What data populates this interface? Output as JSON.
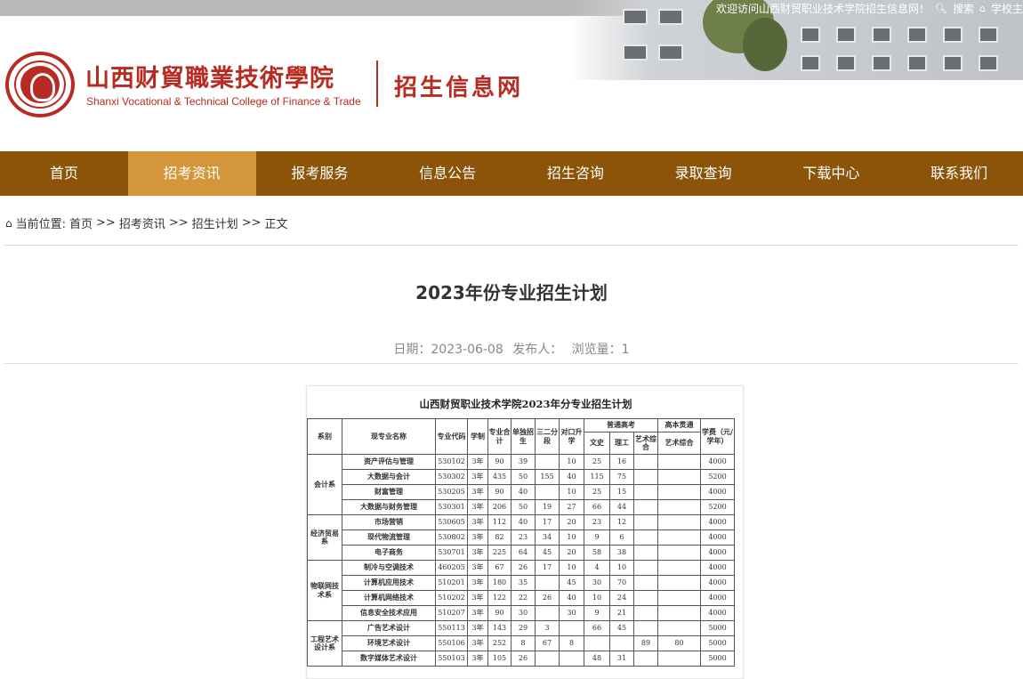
{
  "topbar": {
    "welcome": "欢迎访问山西财贸职业技术学院招生信息网！",
    "search": "搜索",
    "home": "学校主"
  },
  "logo": {
    "school_cn": "山西财貿職業技術學院",
    "school_en": "Shanxi Vocational & Technical College of Finance & Trade",
    "site_title": "招生信息网"
  },
  "nav": [
    "首页",
    "招考资讯",
    "报考服务",
    "信息公告",
    "招生咨询",
    "录取查询",
    "下载中心",
    "联系我们"
  ],
  "nav_active": "招考资讯",
  "breadcrumb": {
    "label": "当前位置:",
    "items": [
      "首页",
      "招考资讯",
      "招生计划",
      "正文"
    ],
    "sep": ">>"
  },
  "article": {
    "title": "2023年份专业招生计划",
    "date": "日期：2023-06-08",
    "publisher": "发布人：",
    "views": "浏览量：1"
  },
  "plan_table": {
    "title": "山西财贸职业技术学院2023年分专业招生计划",
    "headers": {
      "dept": "系别",
      "major": "现专业名称",
      "code": "专业代码",
      "years": "学制",
      "total": "专业合计",
      "single": "单独招生",
      "three_two": "三二分段",
      "duikou": "对口升学",
      "gaokao": "普通高考",
      "wenshi": "文史",
      "ligong": "理工",
      "art": "艺术综合",
      "guantong": "高本贯通",
      "gt_art": "艺术综合",
      "fee": "学费（元/学年）"
    },
    "groups": [
      {
        "dept": "会计系",
        "rows": [
          [
            "资产评估与管理",
            "530102",
            "3年",
            "90",
            "39",
            "",
            "10",
            "25",
            "16",
            "",
            "",
            "4000"
          ],
          [
            "大数据与会计",
            "530302",
            "3年",
            "435",
            "50",
            "155",
            "40",
            "115",
            "75",
            "",
            "",
            "5200"
          ],
          [
            "财富管理",
            "530205",
            "3年",
            "90",
            "40",
            "",
            "10",
            "25",
            "15",
            "",
            "",
            "4000"
          ],
          [
            "大数据与财务管理",
            "530301",
            "3年",
            "206",
            "50",
            "19",
            "27",
            "66",
            "44",
            "",
            "",
            "5200"
          ]
        ]
      },
      {
        "dept": "经济贸易系",
        "rows": [
          [
            "市场营销",
            "530605",
            "3年",
            "112",
            "40",
            "17",
            "20",
            "23",
            "12",
            "",
            "",
            "4000"
          ],
          [
            "现代物流管理",
            "530802",
            "3年",
            "82",
            "23",
            "34",
            "10",
            "9",
            "6",
            "",
            "",
            "4000"
          ],
          [
            "电子商务",
            "530701",
            "3年",
            "225",
            "64",
            "45",
            "20",
            "58",
            "38",
            "",
            "",
            "4000"
          ]
        ]
      },
      {
        "dept": "物联网技术系",
        "rows": [
          [
            "制冷与空调技术",
            "460205",
            "3年",
            "67",
            "26",
            "17",
            "10",
            "4",
            "10",
            "",
            "",
            "4000"
          ],
          [
            "计算机应用技术",
            "510201",
            "3年",
            "180",
            "35",
            "",
            "45",
            "30",
            "70",
            "",
            "",
            "4000"
          ],
          [
            "计算机网络技术",
            "510202",
            "3年",
            "122",
            "22",
            "26",
            "40",
            "10",
            "24",
            "",
            "",
            "4000"
          ],
          [
            "信息安全技术应用",
            "510207",
            "3年",
            "90",
            "30",
            "",
            "30",
            "9",
            "21",
            "",
            "",
            "4000"
          ]
        ]
      },
      {
        "dept": "工程艺术设计系",
        "rows": [
          [
            "广告艺术设计",
            "550113",
            "3年",
            "143",
            "29",
            "3",
            "",
            "66",
            "45",
            "",
            "",
            "5000"
          ],
          [
            "环境艺术设计",
            "550106",
            "3年",
            "252",
            "8",
            "67",
            "8",
            "",
            "",
            "89",
            "80",
            "5000"
          ],
          [
            "数字媒体艺术设计",
            "550103",
            "3年",
            "105",
            "26",
            "",
            "",
            "48",
            "31",
            "",
            "",
            "5000"
          ]
        ]
      }
    ]
  },
  "colors": {
    "nav_bg": "#8b5409",
    "nav_active": "#d4963a",
    "brand_red": "#b72b22"
  }
}
